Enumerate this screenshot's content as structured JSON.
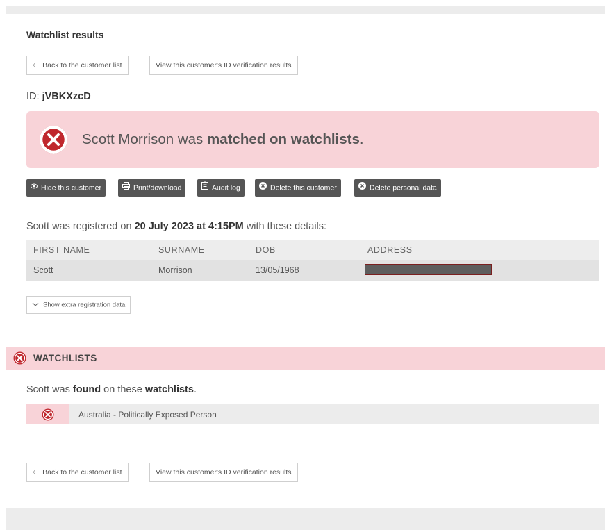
{
  "page": {
    "title": "Watchlist results"
  },
  "nav": {
    "back_label": "Back to the customer list",
    "view_id_label": "View this customer's ID verification results"
  },
  "customer": {
    "id_prefix": "ID: ",
    "id": "jVBKXzcD"
  },
  "alert": {
    "name": "Scott Morrison",
    "text_mid": " was ",
    "text_bold": "matched on watchlists",
    "text_end": "."
  },
  "actions": {
    "hide": "Hide this customer",
    "print": "Print/download",
    "audit": "Audit log",
    "delete_customer": "Delete this customer",
    "delete_personal": "Delete personal data"
  },
  "registration": {
    "prefix": "Scott was registered on ",
    "datetime": "20 July 2023 at 4:15PM",
    "suffix": " with these details:",
    "headers": [
      "FIRST NAME",
      "SURNAME",
      "DOB",
      "ADDRESS"
    ],
    "row": {
      "first_name": "Scott",
      "surname": "Morrison",
      "dob": "13/05/1968",
      "address_redacted": true
    },
    "extra_label": "Show extra registration data"
  },
  "watchlists": {
    "section_title": "WATCHLISTS",
    "found_prefix": "Scott was ",
    "found_bold1": "found",
    "found_mid": " on these ",
    "found_bold2": "watchlists",
    "found_end": ".",
    "items": [
      {
        "label": "Australia - Politically Exposed Person"
      }
    ]
  },
  "colors": {
    "alert_bg": "#f8d3d8",
    "error_red": "#c0272d",
    "action_bg": "#555555"
  }
}
